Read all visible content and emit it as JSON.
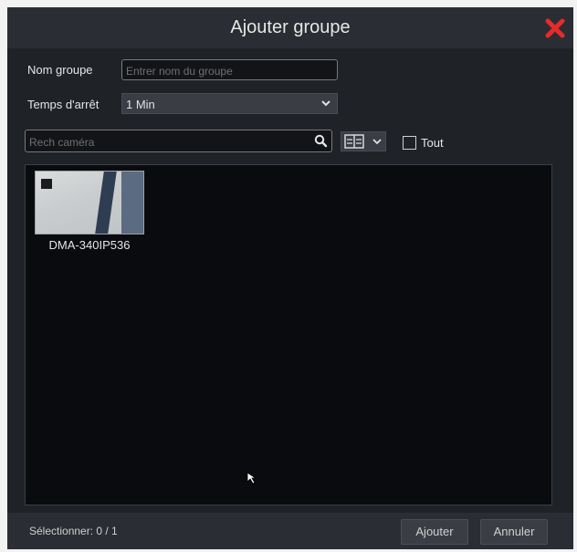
{
  "dialog": {
    "title": "Ajouter groupe",
    "close_icon": "close-icon",
    "accent_color": "#e52b2b"
  },
  "form": {
    "group_name_label": "Nom groupe",
    "group_name_placeholder": "Entrer nom du groupe",
    "dwell_label": "Temps d'arrêt",
    "dwell_value": "1 Min"
  },
  "search": {
    "placeholder": "Rech caméra",
    "search_icon": "search-icon",
    "view_icon": "view-toggle-icon",
    "select_all_label": "Tout"
  },
  "cameras": [
    {
      "name": "DMA-340IP536"
    }
  ],
  "footer": {
    "selection_text": "Sélectionner: 0 / 1",
    "add_label": "Ajouter",
    "cancel_label": "Annuler"
  }
}
